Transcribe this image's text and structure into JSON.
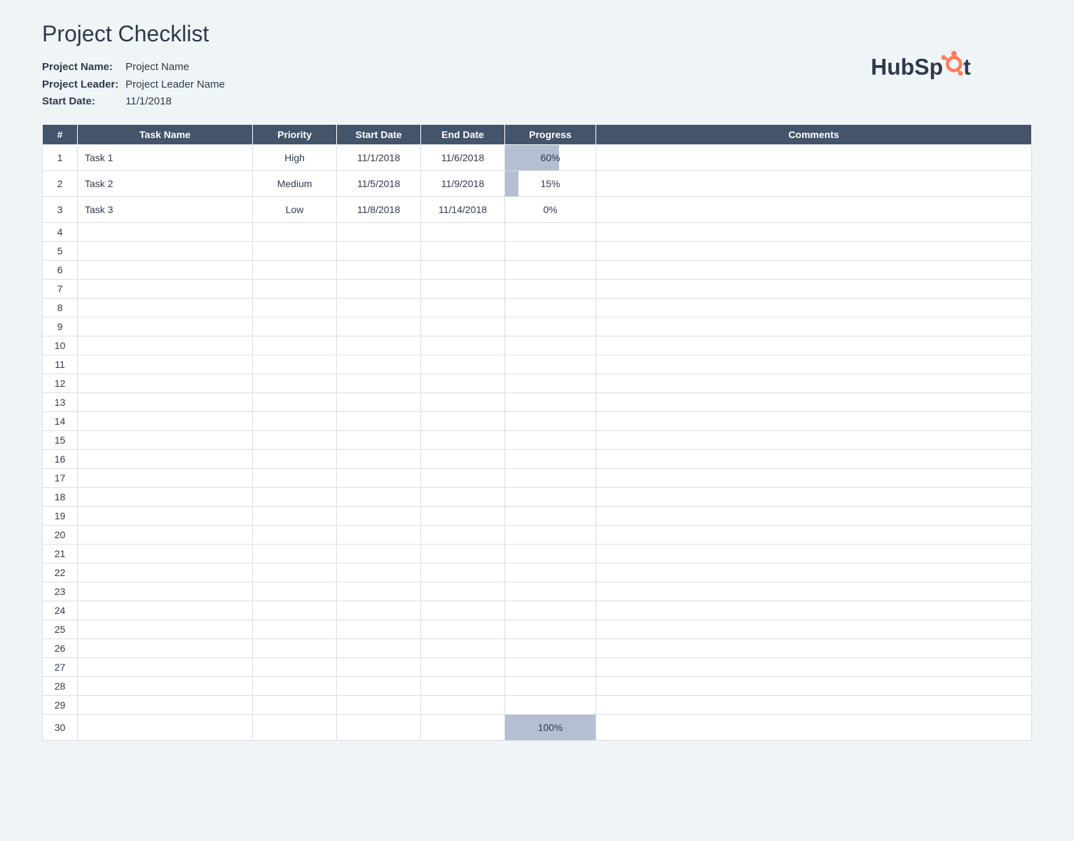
{
  "header": {
    "title": "Project Checklist",
    "meta": [
      {
        "label": "Project Name:",
        "value": "Project Name"
      },
      {
        "label": "Project Leader:",
        "value": "Project Leader Name"
      },
      {
        "label": "Start Date:",
        "value": "11/1/2018"
      }
    ],
    "logo_text": "HubSpot"
  },
  "table": {
    "columns": [
      "#",
      "Task Name",
      "Priority",
      "Start Date",
      "End Date",
      "Progress",
      "Comments"
    ],
    "total_rows": 30,
    "rows": [
      {
        "n": 1,
        "task": "Task 1",
        "priority": "High",
        "start": "11/1/2018",
        "end": "11/6/2018",
        "progress": 60,
        "comments": ""
      },
      {
        "n": 2,
        "task": "Task 2",
        "priority": "Medium",
        "start": "11/5/2018",
        "end": "11/9/2018",
        "progress": 15,
        "comments": ""
      },
      {
        "n": 3,
        "task": "Task 3",
        "priority": "Low",
        "start": "11/8/2018",
        "end": "11/14/2018",
        "progress": 0,
        "comments": ""
      },
      {
        "n": 4
      },
      {
        "n": 5
      },
      {
        "n": 6
      },
      {
        "n": 7
      },
      {
        "n": 8
      },
      {
        "n": 9
      },
      {
        "n": 10
      },
      {
        "n": 11
      },
      {
        "n": 12
      },
      {
        "n": 13
      },
      {
        "n": 14
      },
      {
        "n": 15
      },
      {
        "n": 16
      },
      {
        "n": 17
      },
      {
        "n": 18
      },
      {
        "n": 19
      },
      {
        "n": 20
      },
      {
        "n": 21
      },
      {
        "n": 22
      },
      {
        "n": 23
      },
      {
        "n": 24
      },
      {
        "n": 25
      },
      {
        "n": 26
      },
      {
        "n": 27
      },
      {
        "n": 28
      },
      {
        "n": 29
      },
      {
        "n": 30,
        "progress": 100
      }
    ]
  },
  "colors": {
    "header_bg": "#44546a",
    "priority_high": "#d9534f",
    "priority_medium": "#e8a55c",
    "priority_low": "#3cbfa0",
    "progress_fill": "#b4c0d1"
  }
}
